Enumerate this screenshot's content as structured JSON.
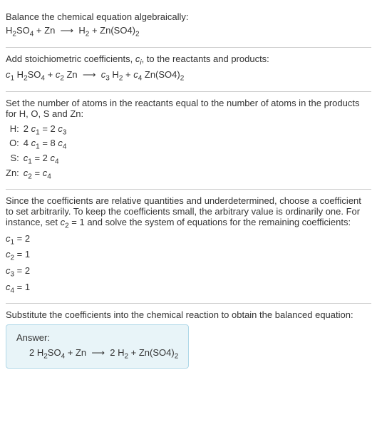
{
  "section1": {
    "intro": "Balance the chemical equation algebraically:",
    "equation_html": "H<span class='sub'>2</span>SO<span class='sub'>4</span> + Zn &nbsp;⟶&nbsp; H<span class='sub'>2</span> + Zn(SO4)<span class='sub'>2</span>"
  },
  "section2": {
    "intro_html": "Add stoichiometric coefficients, <span class='italic'>c<span class='sub'>i</span></span>, to the reactants and products:",
    "equation_html": "<span class='italic'>c</span><span class='sub'>1</span> H<span class='sub'>2</span>SO<span class='sub'>4</span> + <span class='italic'>c</span><span class='sub'>2</span> Zn &nbsp;⟶&nbsp; <span class='italic'>c</span><span class='sub'>3</span> H<span class='sub'>2</span> + <span class='italic'>c</span><span class='sub'>4</span> Zn(SO4)<span class='sub'>2</span>"
  },
  "section3": {
    "intro": "Set the number of atoms in the reactants equal to the number of atoms in the products for H, O, S and Zn:",
    "rows": [
      {
        "el": "H:",
        "eq_html": "2 <span class='italic'>c</span><span class='sub'>1</span> = 2 <span class='italic'>c</span><span class='sub'>3</span>"
      },
      {
        "el": "O:",
        "eq_html": "4 <span class='italic'>c</span><span class='sub'>1</span> = 8 <span class='italic'>c</span><span class='sub'>4</span>"
      },
      {
        "el": "S:",
        "eq_html": "<span class='italic'>c</span><span class='sub'>1</span> = 2 <span class='italic'>c</span><span class='sub'>4</span>"
      },
      {
        "el": "Zn:",
        "eq_html": "<span class='italic'>c</span><span class='sub'>2</span> = <span class='italic'>c</span><span class='sub'>4</span>"
      }
    ]
  },
  "section4": {
    "intro_html": "Since the coefficients are relative quantities and underdetermined, choose a coefficient to set arbitrarily. To keep the coefficients small, the arbitrary value is ordinarily one. For instance, set <span class='italic'>c</span><span class='sub'>2</span> = 1 and solve the system of equations for the remaining coefficients:",
    "lines_html": [
      "<span class='italic'>c</span><span class='sub'>1</span> = 2",
      "<span class='italic'>c</span><span class='sub'>2</span> = 1",
      "<span class='italic'>c</span><span class='sub'>3</span> = 2",
      "<span class='italic'>c</span><span class='sub'>4</span> = 1"
    ]
  },
  "section5": {
    "intro": "Substitute the coefficients into the chemical reaction to obtain the balanced equation:",
    "answer_label": "Answer:",
    "answer_eq_html": "2 H<span class='sub'>2</span>SO<span class='sub'>4</span> + Zn &nbsp;⟶&nbsp; 2 H<span class='sub'>2</span> + Zn(SO4)<span class='sub'>2</span>"
  }
}
